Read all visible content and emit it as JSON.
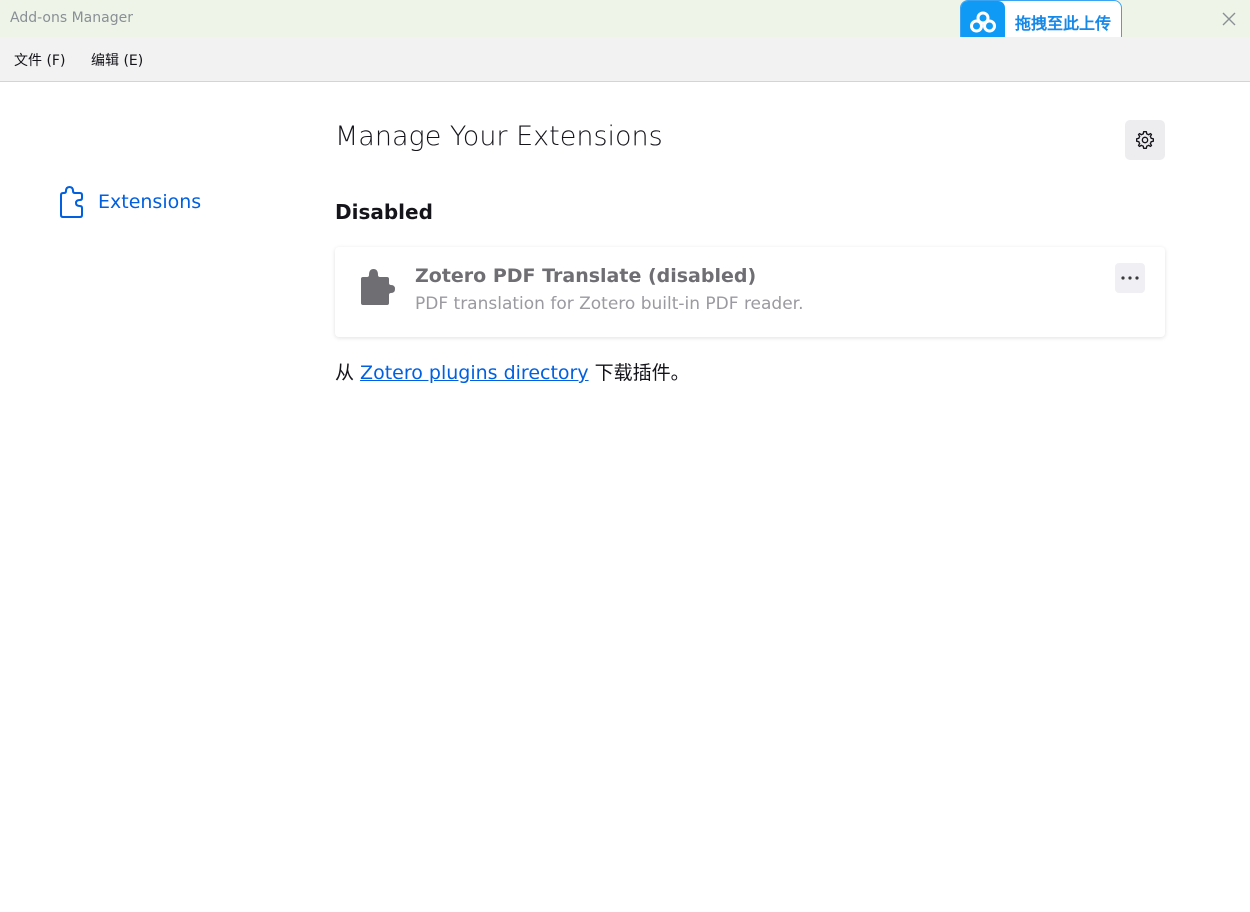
{
  "window": {
    "title": "Add-ons Manager"
  },
  "upload_widget": {
    "label": "拖拽至此上传",
    "icon": "cloud-link-icon",
    "color": "#0f9bf5"
  },
  "menubar": {
    "items": [
      {
        "label": "文件 (F)"
      },
      {
        "label": "编辑 (E)"
      }
    ]
  },
  "sidebar": {
    "items": [
      {
        "label": "Extensions",
        "icon": "puzzle-icon",
        "selected": true
      }
    ]
  },
  "main": {
    "title": "Manage Your Extensions",
    "section_heading": "Disabled",
    "addons": [
      {
        "name": "Zotero PDF Translate (disabled)",
        "description": "PDF translation for Zotero built-in PDF reader.",
        "icon": "puzzle-piece-icon"
      }
    ],
    "footer": {
      "prefix": "从 ",
      "link_text": "Zotero plugins directory",
      "suffix": " 下载插件。"
    }
  },
  "colors": {
    "accent": "#0060df",
    "titlebar_bg": "#eef5e8",
    "menubar_bg": "#f2f2f2"
  }
}
